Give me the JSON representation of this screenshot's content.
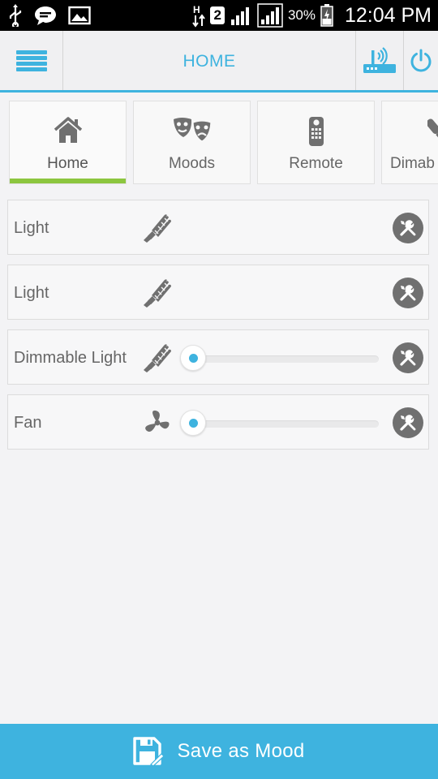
{
  "status_bar": {
    "battery_percent": "30%",
    "time": "12:04 PM",
    "sim_label": "2",
    "icons": [
      "usb-icon",
      "chat-icon",
      "gallery-icon",
      "data-transfer-icon",
      "sim-icon",
      "signal-icon",
      "signal-icon",
      "battery-icon"
    ]
  },
  "header": {
    "title": "HOME",
    "menu_icon": "hamburger-icon",
    "hub_icon": "hub-icon",
    "power_icon": "power-icon"
  },
  "tabs": [
    {
      "label": "Home",
      "icon": "home-icon",
      "active": true
    },
    {
      "label": "Moods",
      "icon": "masks-icon",
      "active": false
    },
    {
      "label": "Remote",
      "icon": "remote-icon",
      "active": false
    },
    {
      "label": "Dimab",
      "icon": "bulb-icon",
      "active": false
    }
  ],
  "devices": [
    {
      "name": "Light",
      "icon": "cfl-bulb-icon",
      "has_slider": false
    },
    {
      "name": "Light",
      "icon": "cfl-bulb-icon",
      "has_slider": false
    },
    {
      "name": "Dimmable Light",
      "icon": "cfl-bulb-icon",
      "has_slider": true,
      "level": 0
    },
    {
      "name": "Fan",
      "icon": "fan-icon",
      "has_slider": true,
      "level": 0
    }
  ],
  "footer": {
    "save_label": "Save as Mood",
    "save_icon": "save-icon"
  },
  "colors": {
    "accent": "#3eb3df",
    "active_tab_underline": "#8cc63f",
    "icon_gray": "#707070",
    "background": "#f3f3f5"
  }
}
